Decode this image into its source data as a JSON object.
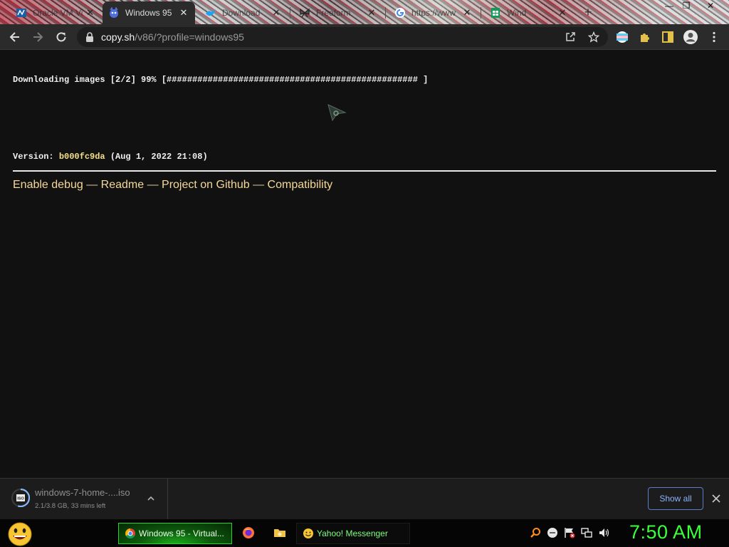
{
  "browser": {
    "tabs": [
      {
        "title": "Oracle VM VirtualBox",
        "active": false,
        "icon": "virtualbox-icon"
      },
      {
        "title": "Windows 95",
        "active": true,
        "icon": "v86-icon"
      },
      {
        "title": "Download",
        "active": false,
        "icon": "bird-icon"
      },
      {
        "title": "Freeform",
        "active": false,
        "icon": "butterfly-icon"
      },
      {
        "title": "https://www",
        "active": false,
        "icon": "google-icon"
      },
      {
        "title": "Wind",
        "active": false,
        "icon": "sheet-icon"
      }
    ],
    "close_glyph": "✕",
    "new_tab_glyph": "+",
    "window_controls": {
      "minimize": "—",
      "maximize": "❐",
      "close": "✕"
    },
    "address": {
      "host": "copy.sh",
      "path": "/v86/?profile=windows95"
    }
  },
  "page": {
    "download_status": "Downloading images [2/2] 99% [################################################# ]",
    "version_label": "Version: ",
    "version_hash": "b000fc9da",
    "version_date": " (Aug 1, 2022 21:08)",
    "links": [
      {
        "label": "Enable debug"
      },
      {
        "label": "Readme"
      },
      {
        "label": "Project on Github"
      },
      {
        "label": "Compatibility"
      }
    ],
    "link_separator": " — "
  },
  "downloads": {
    "file_name": "windows-7-home-....iso",
    "progress_text": "2.1/3.8 GB, 33 mins left",
    "progress": 0.55,
    "icon_label": "ISO",
    "show_all_label": "Show all"
  },
  "taskbar": {
    "tasks": [
      {
        "label": "Windows 95 - Virtual...",
        "active": true
      },
      {
        "label": "Yahoo! Messenger",
        "active": false
      }
    ],
    "clock": "7:50 AM"
  },
  "colors": {
    "page_background": "#111111",
    "link": "#f5d99a",
    "hash": "#f4e08a",
    "clock": "#3cff3c",
    "show_all": "#8ab4f8"
  }
}
